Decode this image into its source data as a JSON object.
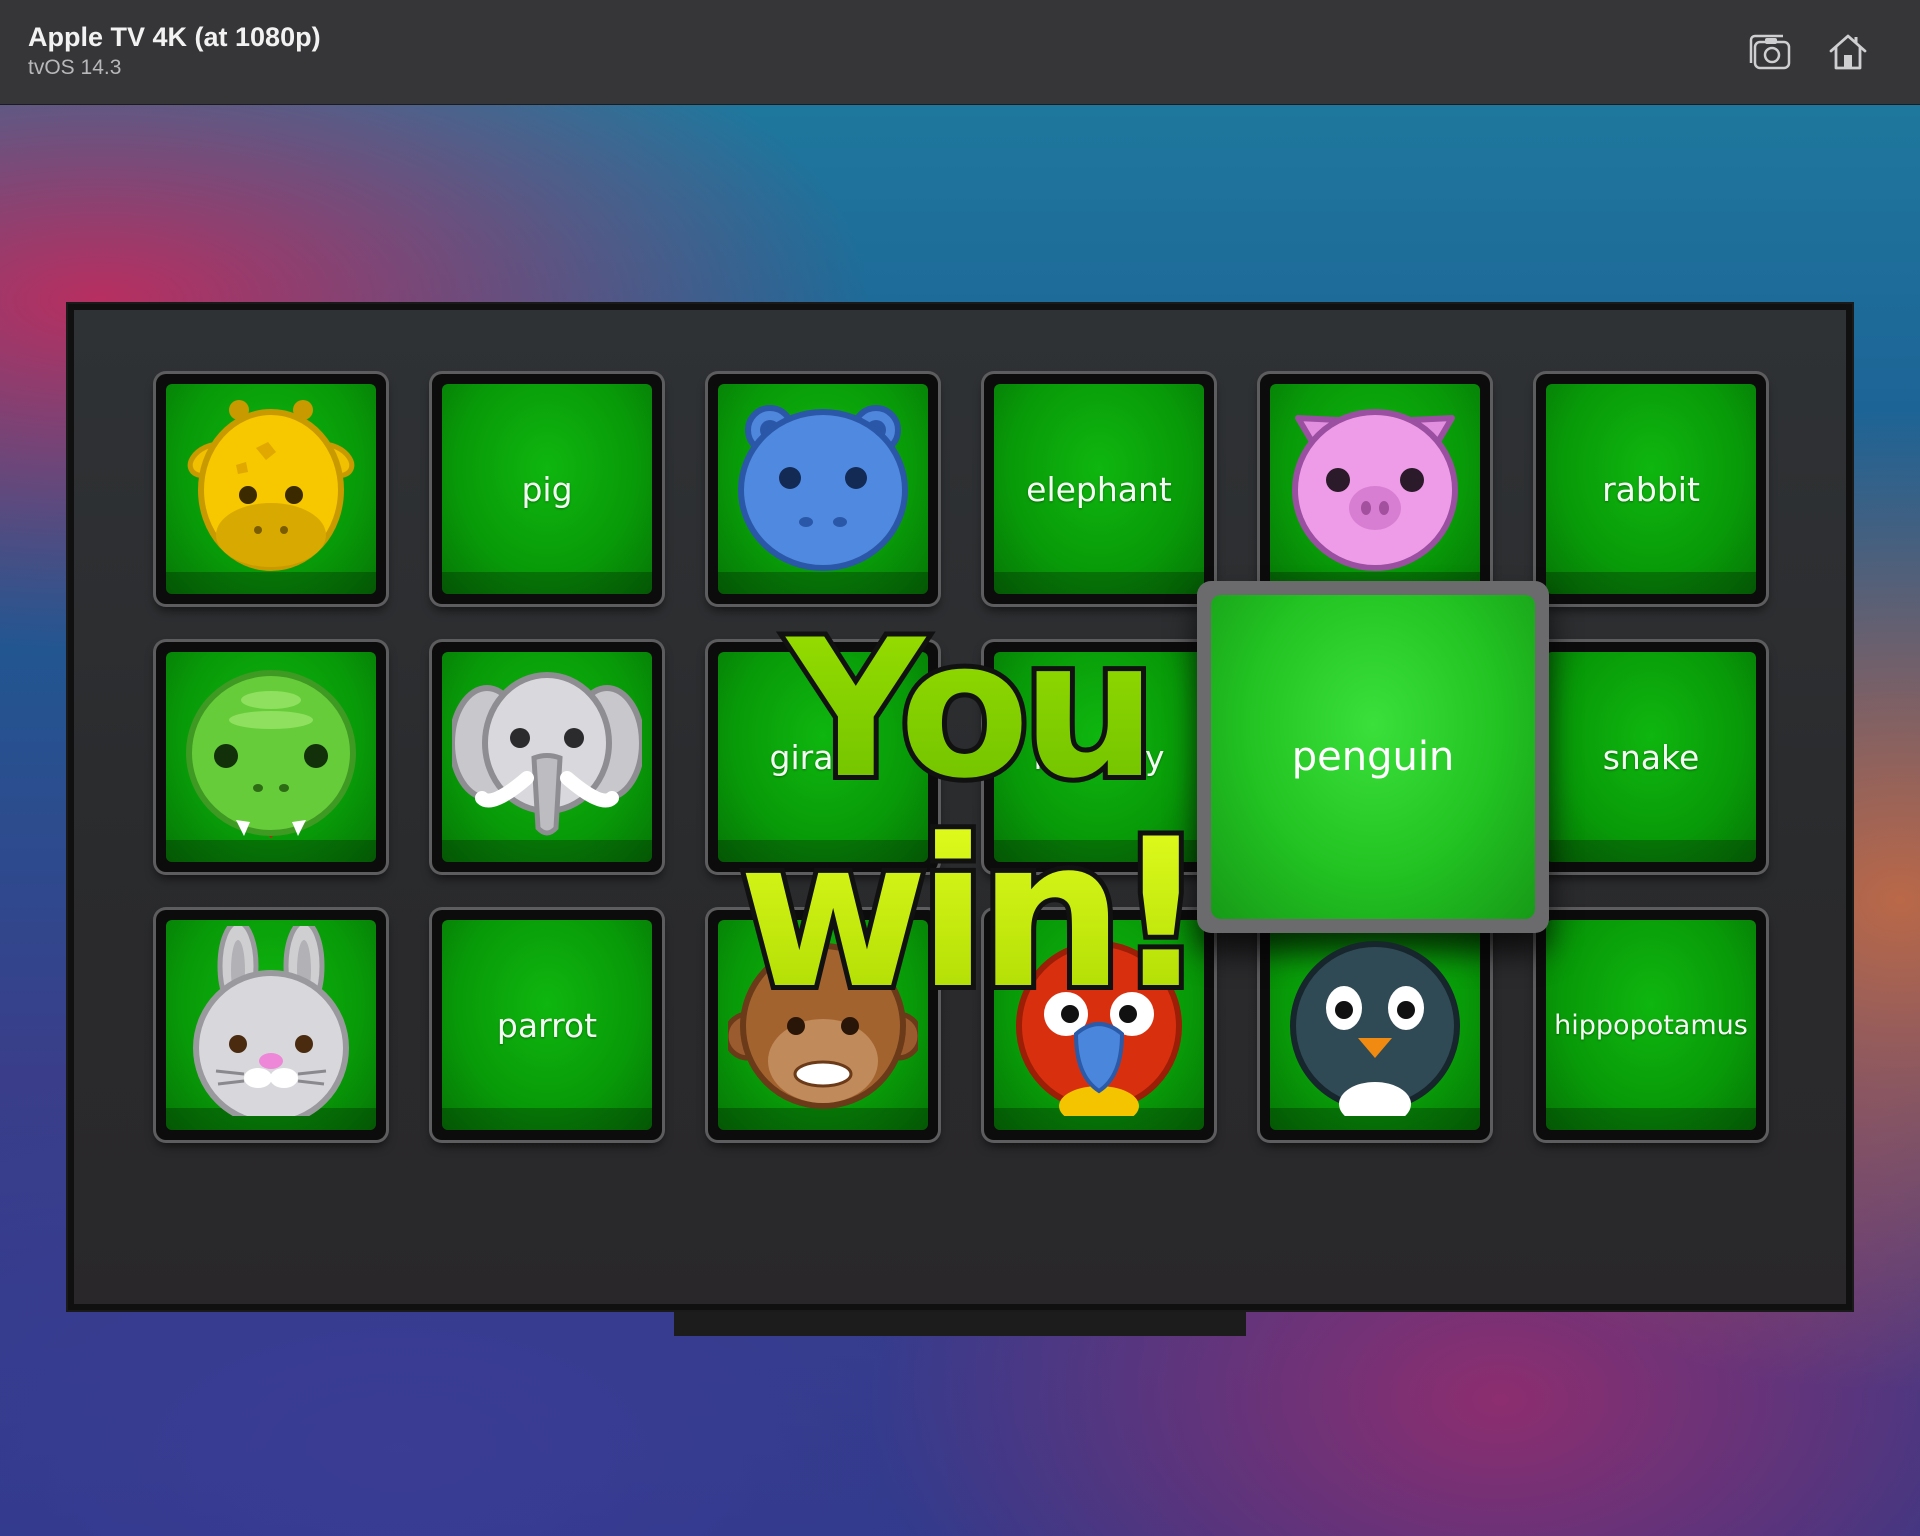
{
  "window": {
    "title": "Apple TV 4K (at 1080p)",
    "subtitle": "tvOS 14.3",
    "buttons": [
      {
        "icon": "screenshot-icon"
      },
      {
        "icon": "home-icon"
      }
    ]
  },
  "game": {
    "tiles": [
      {
        "kind": "image",
        "animal": "giraffe"
      },
      {
        "kind": "word",
        "text": "pig"
      },
      {
        "kind": "image",
        "animal": "hippopotamus"
      },
      {
        "kind": "word",
        "text": "elephant"
      },
      {
        "kind": "image",
        "animal": "pig"
      },
      {
        "kind": "word",
        "text": "rabbit"
      },
      {
        "kind": "image",
        "animal": "snake"
      },
      {
        "kind": "image",
        "animal": "elephant"
      },
      {
        "kind": "word",
        "text": "giraffe"
      },
      {
        "kind": "word",
        "text": "monkey"
      },
      {
        "kind": "word",
        "text": "penguin",
        "focused": true
      },
      {
        "kind": "word",
        "text": "snake"
      },
      {
        "kind": "image",
        "animal": "rabbit"
      },
      {
        "kind": "word",
        "text": "parrot"
      },
      {
        "kind": "image",
        "animal": "monkey"
      },
      {
        "kind": "image",
        "animal": "parrot"
      },
      {
        "kind": "image",
        "animal": "penguin"
      },
      {
        "kind": "word",
        "text": "hippopotamus"
      }
    ],
    "focused_label": "penguin",
    "win_line1": "You",
    "win_line2": "win!",
    "colors": {
      "tile_green": "#089a08",
      "focused_green": "#22c322",
      "win_yellow": "#c6e800",
      "win_green": "#7cc400"
    }
  }
}
